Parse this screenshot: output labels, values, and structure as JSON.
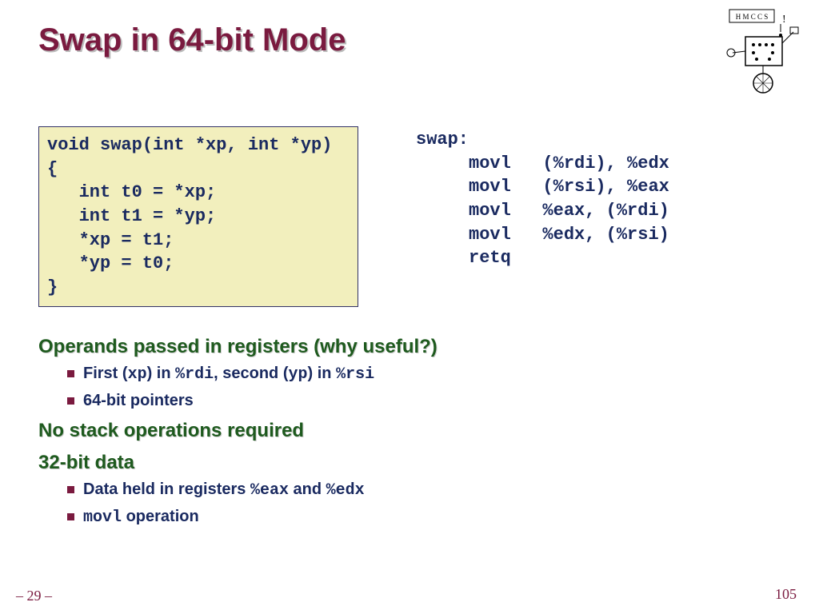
{
  "title": "Swap in 64-bit Mode",
  "logo": {
    "top": "H M C  C S !",
    "alt": "robot-logo"
  },
  "code_c": "void swap(int *xp, int *yp)\n{\n   int t0 = *xp;\n   int t1 = *yp;\n   *xp = t1;\n   *yp = t0;\n}",
  "code_asm": "swap:\n     movl   (%rdi), %edx\n     movl   (%rsi), %eax\n     movl   %eax, (%rdi)\n     movl   %edx, (%rsi)\n     retq",
  "sections": {
    "s1": {
      "head": "Operands passed in registers (why useful?)",
      "b1_a": "First (",
      "b1_b": "xp",
      "b1_c": ") in ",
      "b1_d": "%rdi",
      "b1_e": ", second (",
      "b1_f": "yp",
      "b1_g": ") in ",
      "b1_h": "%rsi",
      "b2": "64-bit pointers"
    },
    "s2": {
      "head": "No stack operations required"
    },
    "s3": {
      "head": "32-bit data",
      "b1_a": "Data held in registers ",
      "b1_b": "%eax",
      "b1_c": " and ",
      "b1_d": "%edx",
      "b2_a": "movl",
      "b2_b": " operation"
    }
  },
  "page_left": "– 29 –",
  "page_right": "105"
}
